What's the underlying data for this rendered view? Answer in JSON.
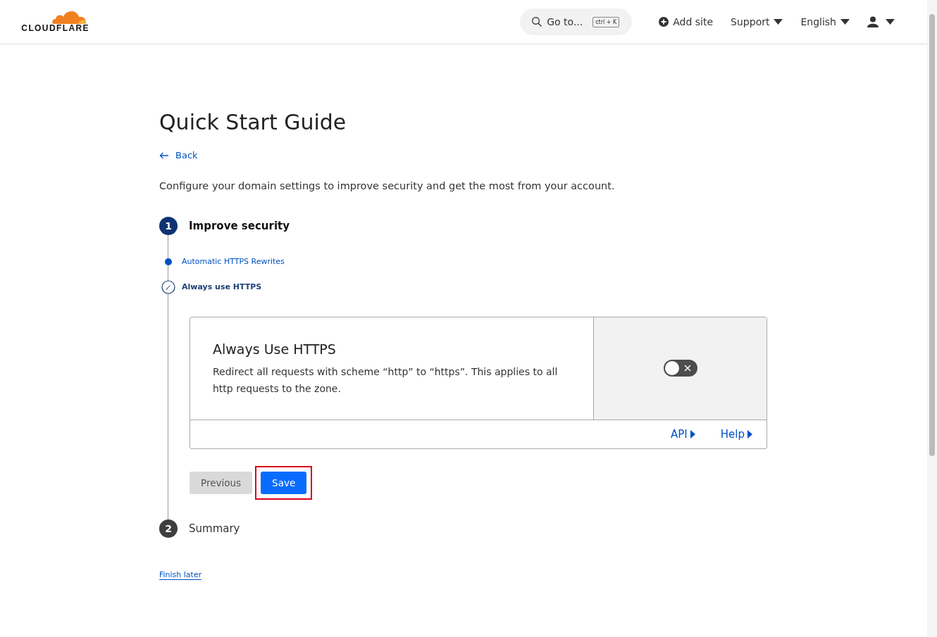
{
  "header": {
    "logo": "CLOUDFLARE",
    "search": {
      "placeholder": "Go to...",
      "shortcut": "ctrl + K"
    },
    "nav": [
      {
        "label": "Add site",
        "kind": "add"
      },
      {
        "label": "Support",
        "kind": "menu"
      },
      {
        "label": "English",
        "kind": "menu"
      },
      {
        "kind": "user"
      }
    ]
  },
  "page": {
    "title": "Quick Start Guide",
    "back": "Back",
    "intro": "Configure your domain settings to improve security and get the most from your account."
  },
  "steps": [
    {
      "number": "1",
      "label": "Improve security",
      "active": true,
      "substeps": [
        {
          "label": "Automatic HTTPS Rewrites",
          "kind": "done"
        },
        {
          "label": "Always use HTTPS",
          "kind": "current"
        }
      ],
      "card": {
        "title": "Always Use HTTPS",
        "description": "Redirect all requests with scheme “http” to “https”. This applies to all http requests to the zone.",
        "on": false,
        "links": [
          "API",
          "Help"
        ]
      },
      "buttons": [
        {
          "label": "Previous",
          "kind": "secondary",
          "highlighted": false
        },
        {
          "label": "Save",
          "kind": "primary",
          "highlighted": true
        }
      ]
    },
    {
      "number": "2",
      "label": "Summary",
      "active": false
    }
  ],
  "finish_later": "Finish later"
}
